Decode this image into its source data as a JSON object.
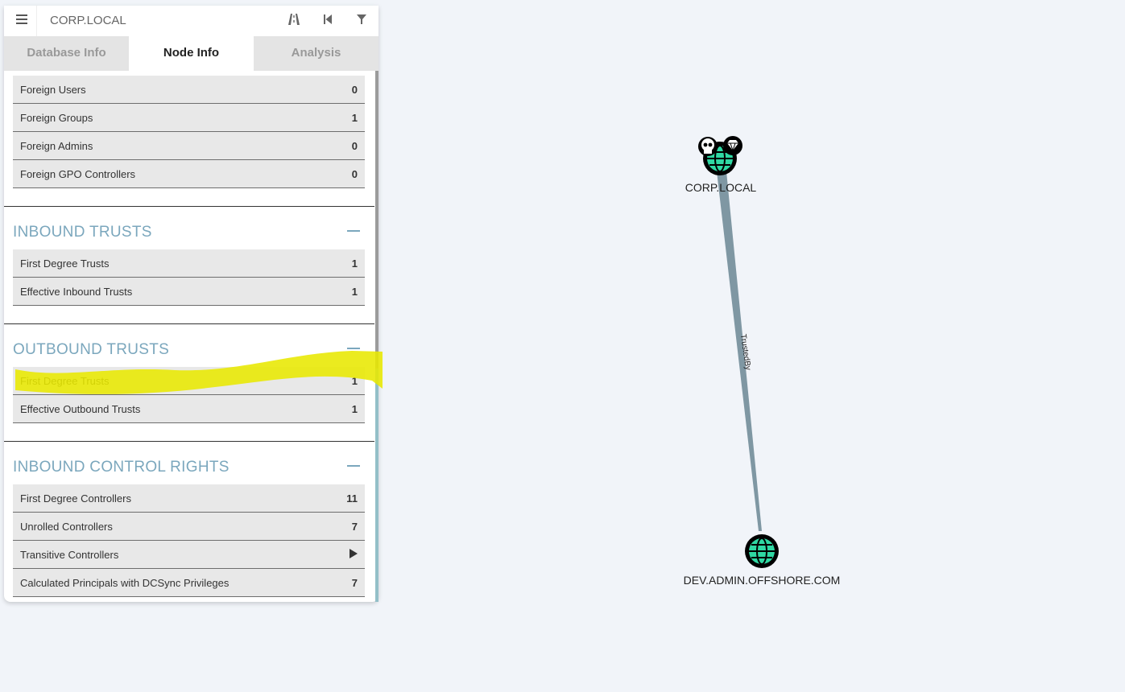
{
  "search": {
    "value": "CORP.LOCAL"
  },
  "toolbar": {
    "pathfinding_icon": "road-icon",
    "back_icon": "skip-back-icon",
    "filter_icon": "filter-icon"
  },
  "tabs": [
    {
      "label": "Database Info",
      "active": false
    },
    {
      "label": "Node Info",
      "active": true
    },
    {
      "label": "Analysis",
      "active": false
    }
  ],
  "foreign": [
    {
      "label": "Foreign Users",
      "value": "0"
    },
    {
      "label": "Foreign Groups",
      "value": "1"
    },
    {
      "label": "Foreign Admins",
      "value": "0"
    },
    {
      "label": "Foreign GPO Controllers",
      "value": "0"
    }
  ],
  "inbound_trusts": {
    "title": "INBOUND TRUSTS",
    "rows": [
      {
        "label": "First Degree Trusts",
        "value": "1"
      },
      {
        "label": "Effective Inbound Trusts",
        "value": "1"
      }
    ]
  },
  "outbound_trusts": {
    "title": "OUTBOUND TRUSTS",
    "rows": [
      {
        "label": "First Degree Trusts",
        "value": "1"
      },
      {
        "label": "Effective Outbound Trusts",
        "value": "1"
      }
    ]
  },
  "inbound_control": {
    "title": "INBOUND CONTROL RIGHTS",
    "rows": [
      {
        "label": "First Degree Controllers",
        "value": "11"
      },
      {
        "label": "Unrolled Controllers",
        "value": "7"
      },
      {
        "label": "Transitive Controllers",
        "value": ""
      },
      {
        "label": "Calculated Principals with DCSync Privileges",
        "value": "7"
      }
    ]
  },
  "graph": {
    "node_a": "CORP.LOCAL",
    "node_b": "DEV.ADMIN.OFFSHORE.COM",
    "edge_label": "TrustedBy"
  },
  "colors": {
    "accent": "#7ba7bd",
    "globe": "#2fd8a3",
    "highlight": "#e8e800",
    "edge": "#7f97a3"
  }
}
